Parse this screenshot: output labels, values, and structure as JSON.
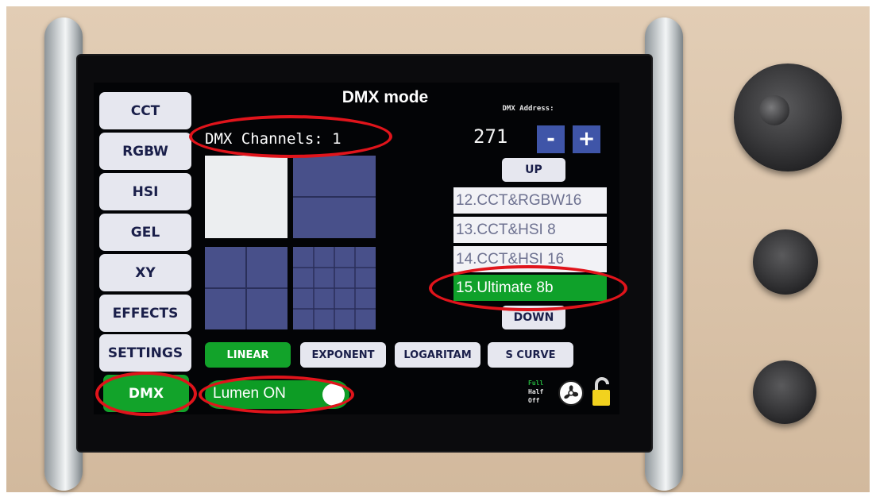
{
  "screen": {
    "title": "DMX mode",
    "channels_text": "DMX Channels: 1"
  },
  "sidebar": {
    "items": [
      {
        "label": "CCT",
        "active": false
      },
      {
        "label": "RGBW",
        "active": false
      },
      {
        "label": "HSI",
        "active": false
      },
      {
        "label": "GEL",
        "active": false
      },
      {
        "label": "XY",
        "active": false
      },
      {
        "label": "EFFECTS",
        "active": false
      },
      {
        "label": "SETTINGS",
        "active": false
      },
      {
        "label": "DMX",
        "active": true
      }
    ]
  },
  "dmx_address": {
    "label": "DMX Address:",
    "value": "271",
    "minus_label": "-",
    "plus_label": "+"
  },
  "mode_list": {
    "up_label": "UP",
    "down_label": "DOWN",
    "items": [
      {
        "label": "12.CCT&RGBW16",
        "selected": false
      },
      {
        "label": "13.CCT&HSI 8",
        "selected": false
      },
      {
        "label": "14.CCT&HSI 16",
        "selected": false
      },
      {
        "label": "15.Ultimate 8b",
        "selected": true
      }
    ]
  },
  "curves": {
    "items": [
      {
        "label": "LINEAR",
        "active": true
      },
      {
        "label": "EXPONENT",
        "active": false
      },
      {
        "label": "LOGARITAM",
        "active": false
      },
      {
        "label": "S CURVE",
        "active": false
      }
    ]
  },
  "lumen_toggle": {
    "label": "Lumen ON",
    "on": true
  },
  "fan": {
    "modes": [
      "Full",
      "Half",
      "Off"
    ]
  },
  "lock": {
    "state": "unlocked"
  },
  "colors": {
    "accent_green": "#12a32a",
    "button_bg": "#e6e7ef",
    "button_text": "#1a1f4a",
    "screen_bg": "#030406",
    "step_button": "#3f55a8",
    "callout_red": "#e0141b",
    "lock_yellow": "#f2d21e"
  }
}
